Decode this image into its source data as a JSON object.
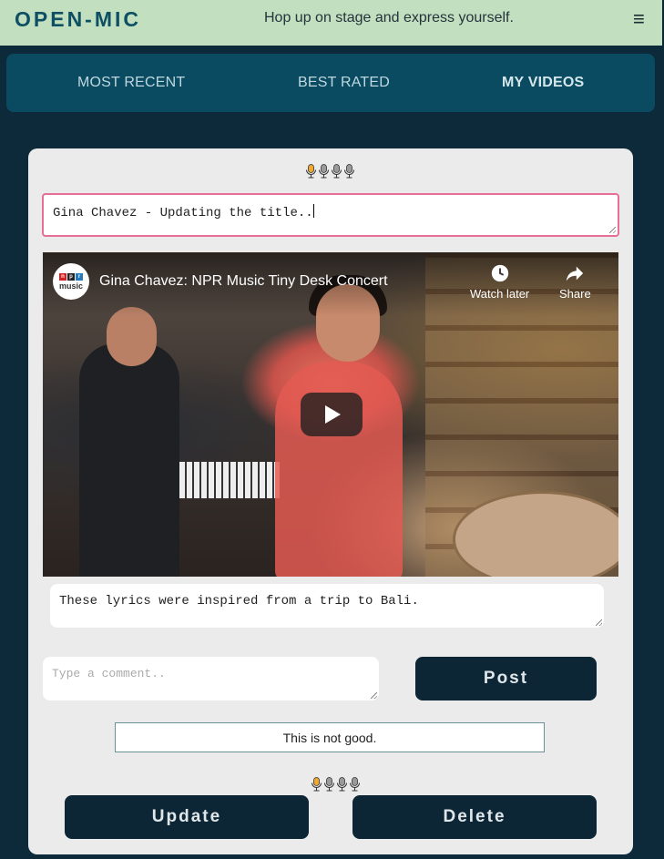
{
  "header": {
    "logo": "OPEN-MIC",
    "tagline": "Hop up on stage and express yourself.",
    "menu_icon": "≡"
  },
  "tabs": [
    {
      "label": "MOST RECENT",
      "active": false
    },
    {
      "label": "BEST RATED",
      "active": false
    },
    {
      "label": "MY VIDEOS",
      "active": true
    }
  ],
  "post": {
    "rating": {
      "filled": 1,
      "total": 4
    },
    "title_value": "Gina Chavez - Updating the title..",
    "video": {
      "title": "Gina Chavez: NPR Music Tiny Desk Concert",
      "channel": "npr music",
      "watch_later": "Watch later",
      "share": "Share"
    },
    "description_value": "These lyrics were inspired from a trip to Bali.",
    "comment_placeholder": "Type a comment..",
    "post_label": "Post",
    "comments": [
      {
        "text": "This is not good.",
        "rating": {
          "filled": 1,
          "total": 4
        }
      }
    ],
    "update_label": "Update",
    "delete_label": "Delete"
  },
  "colors": {
    "header_bg": "#c2dfbf",
    "tabs_bg": "#0a4b62",
    "page_bg": "#0d2a3a",
    "button_bg": "#0d2635",
    "mic_active": "#f0a830",
    "title_border": "#e86e9a"
  }
}
